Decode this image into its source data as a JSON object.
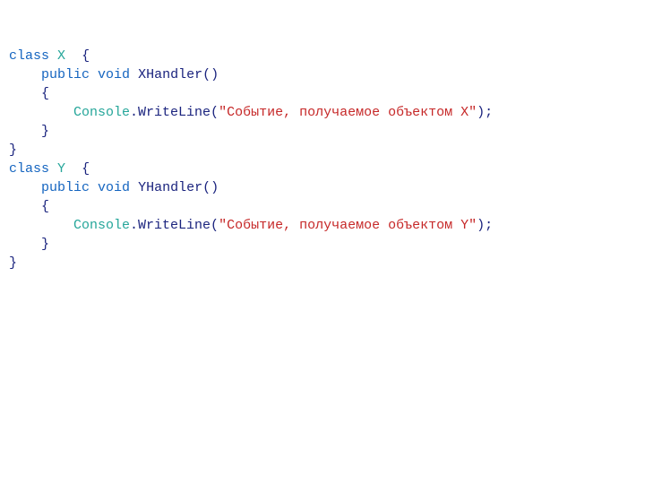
{
  "tokens": {
    "kw_class": "class",
    "kw_public": "public",
    "kw_void": "void",
    "classX": "X",
    "classY": "Y",
    "xhandler": "XHandler()",
    "yhandler": "YHandler()",
    "console": "Console",
    "writeline": ".WriteLine(",
    "str_open": "\"",
    "str_x": "Событие, получаемое объектом X",
    "str_y": "Событие, получаемое объектом Y",
    "str_close": "\"",
    "paren_close_semi": ");",
    "brace_open": "{",
    "brace_close": "}",
    "sp": "  "
  },
  "chart_data": null
}
